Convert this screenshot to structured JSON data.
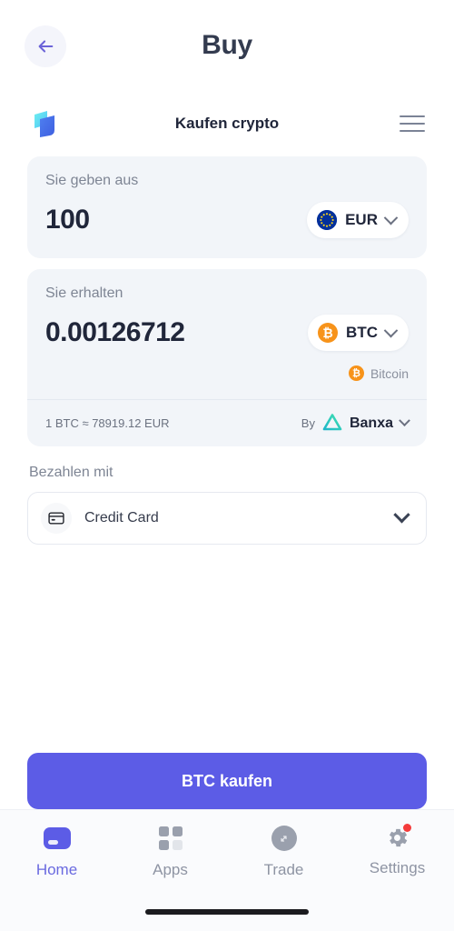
{
  "topbar": {
    "title": "Buy",
    "back_icon": "arrow-left-icon"
  },
  "widget": {
    "title": "Kaufen crypto",
    "logo_icon": "app-logo-icon",
    "menu_icon": "hamburger-menu-icon"
  },
  "spend": {
    "label": "Sie geben aus",
    "amount": "100",
    "placeholder": "0",
    "currency": "EUR",
    "currency_icon": "eur-flag-icon"
  },
  "receive": {
    "label": "Sie erhalten",
    "amount": "0.00126712",
    "placeholder": "0",
    "currency": "BTC",
    "currency_icon": "bitcoin-icon",
    "coin_full_name": "Bitcoin",
    "coin_symbol": "₿"
  },
  "rate": {
    "text": "1 BTC ≈ 78919.12 EUR",
    "by_label": "By",
    "provider": "Banxa",
    "provider_icon": "banxa-triangle-icon"
  },
  "payment": {
    "label": "Bezahlen mit",
    "method": "Credit Card",
    "method_icon": "credit-card-icon",
    "chevron_icon": "chevron-down-icon"
  },
  "cta": {
    "label": "BTC kaufen"
  },
  "tabbar": {
    "items": [
      {
        "label": "Home",
        "icon": "home-icon",
        "active": true,
        "badge": false
      },
      {
        "label": "Apps",
        "icon": "apps-grid-icon",
        "active": false,
        "badge": false
      },
      {
        "label": "Trade",
        "icon": "trade-arrows-icon",
        "active": false,
        "badge": false
      },
      {
        "label": "Settings",
        "icon": "gear-icon",
        "active": false,
        "badge": true
      }
    ]
  },
  "colors": {
    "accent": "#5c5ce6",
    "card_bg": "#f2f5f9",
    "bitcoin": "#f7931a",
    "eu_blue": "#03309b",
    "badge_red": "#f43b3b",
    "title": "#20263a",
    "muted": "#7e8594"
  }
}
